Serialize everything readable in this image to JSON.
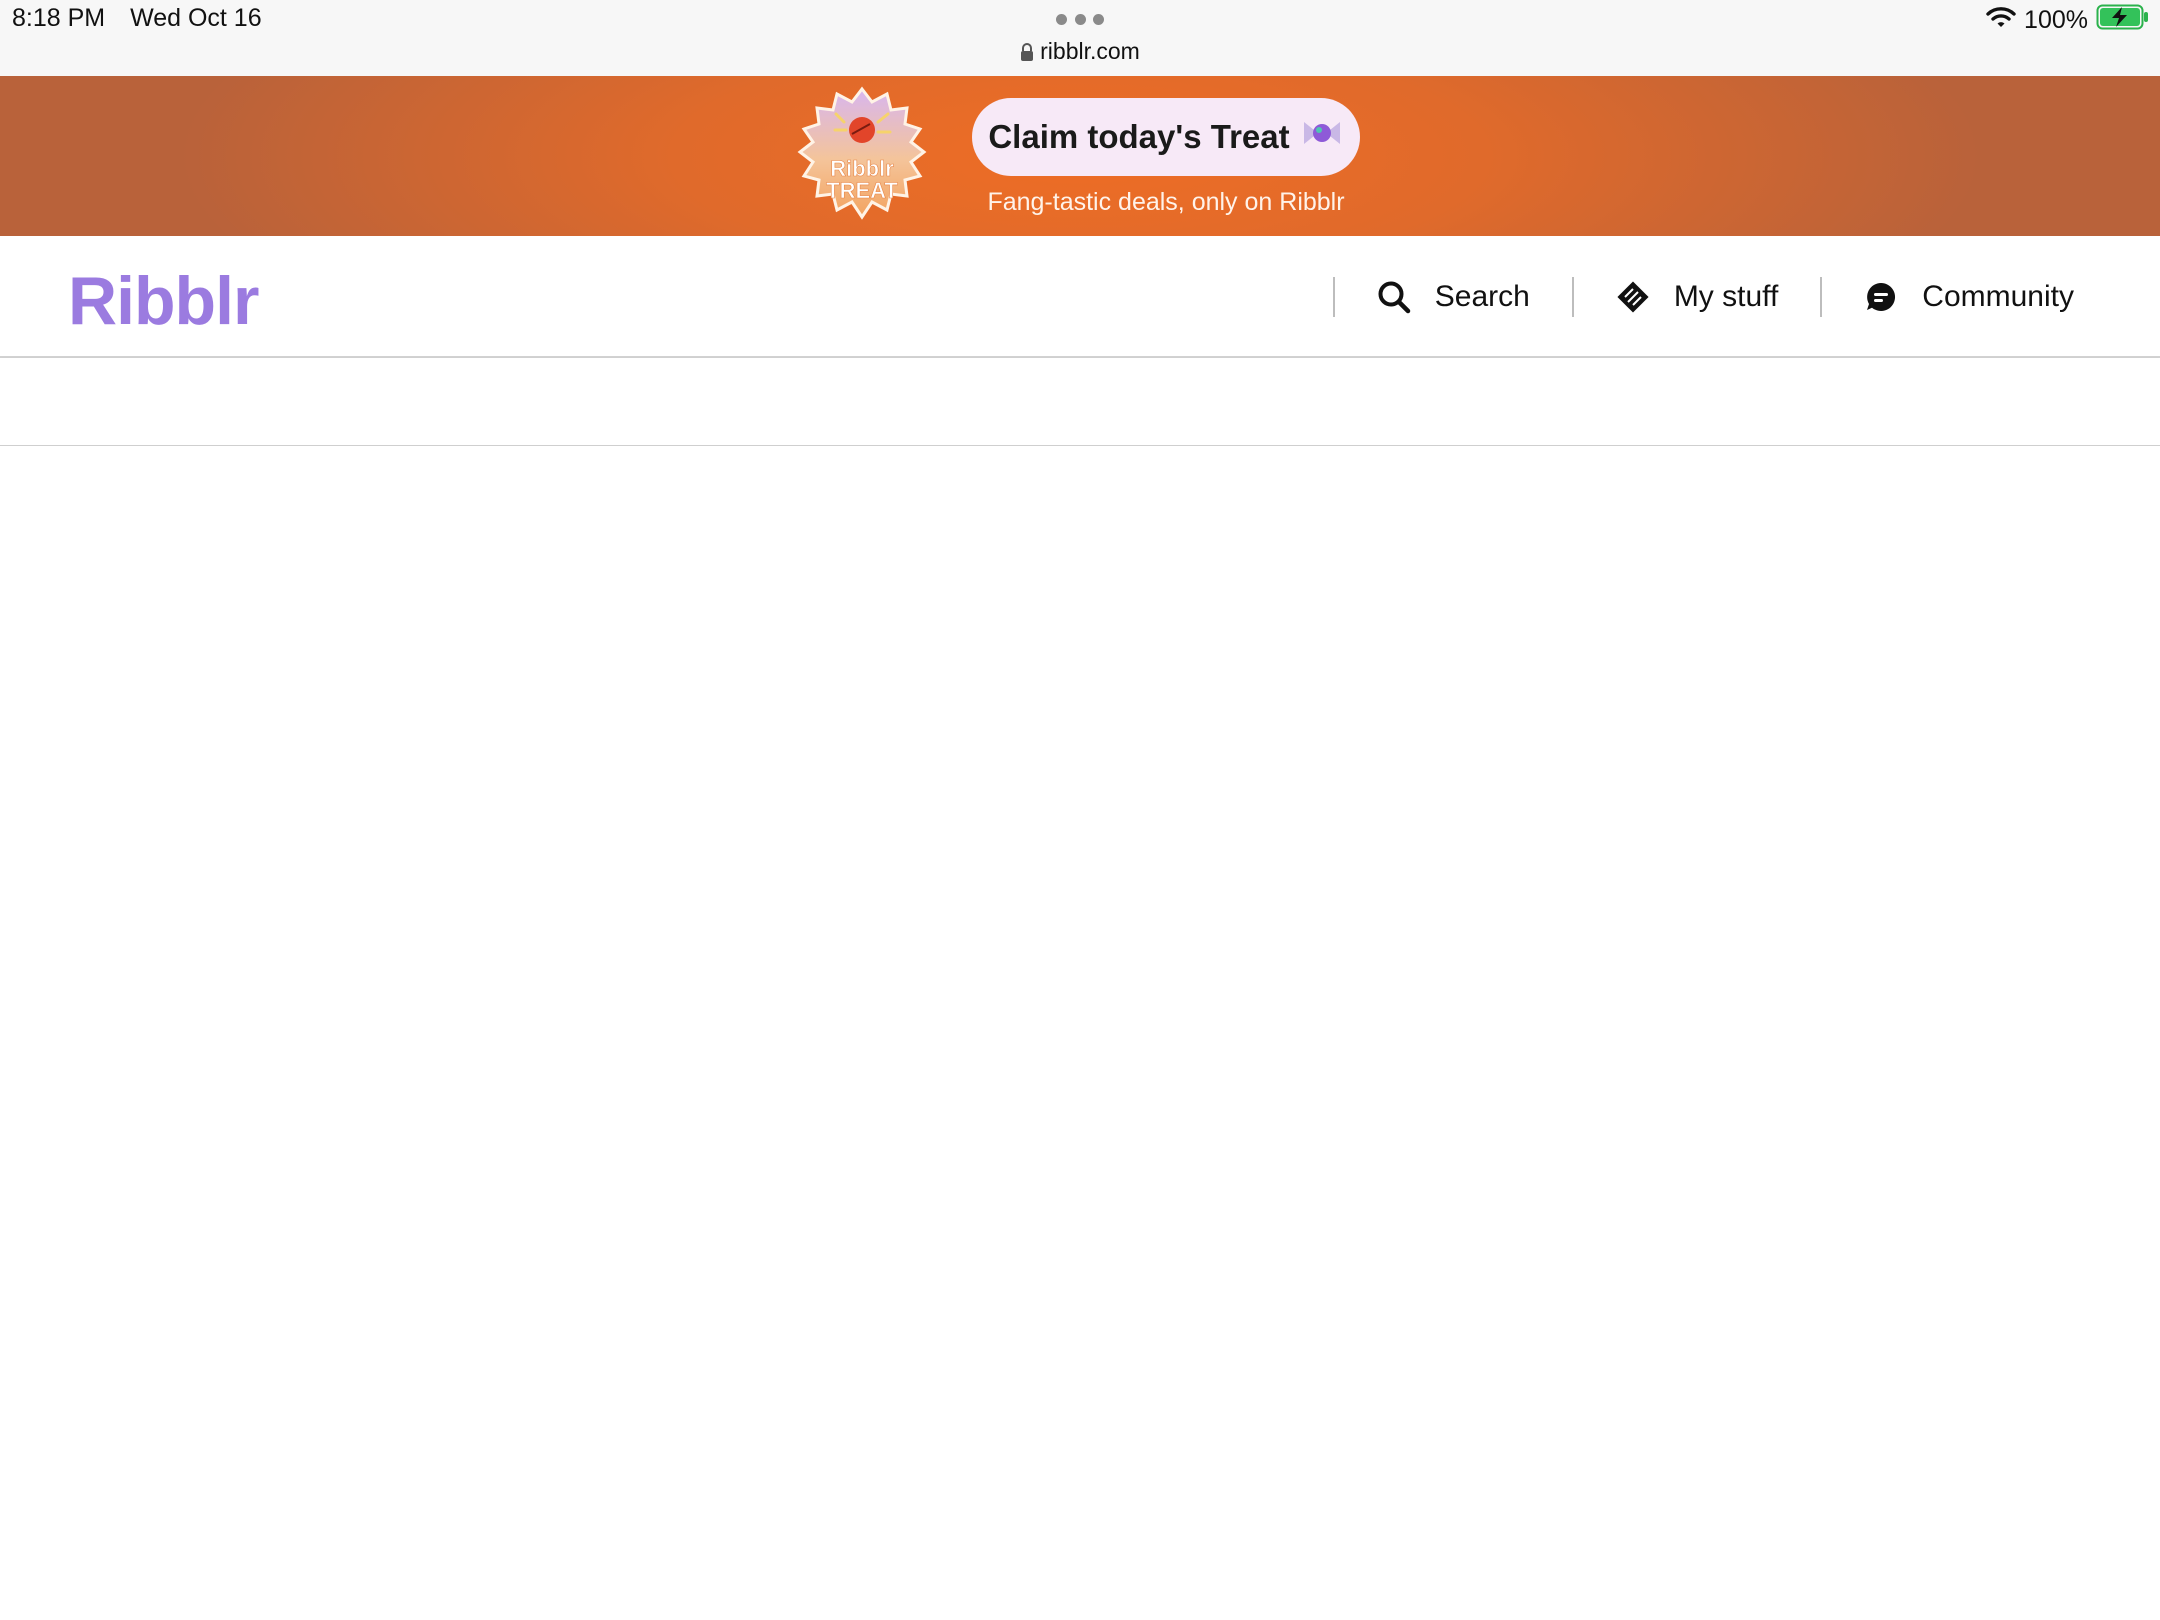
{
  "status_bar": {
    "time": "8:18 PM",
    "date": "Wed Oct 16",
    "url": "ribblr.com",
    "battery": "100%",
    "icons": [
      "lock-icon",
      "wifi-icon",
      "battery-charging-icon",
      "more-dots-icon"
    ]
  },
  "promo": {
    "badge_text_line1": "Ribblr",
    "badge_text_line2": "TREAT",
    "button_label": "Claim today's Treat",
    "subtitle": "Fang-tastic deals, only on Ribblr",
    "colors": {
      "banner": "#e86b27",
      "button": "#f7e9f7"
    }
  },
  "header": {
    "logo": "Ribblr",
    "logo_color": "#9b7be0",
    "nav": [
      {
        "label": "Search",
        "icon": "search-icon"
      },
      {
        "label": "My stuff",
        "icon": "my-stuff-icon"
      },
      {
        "label": "Community",
        "icon": "chat-bubble-icon"
      }
    ]
  }
}
